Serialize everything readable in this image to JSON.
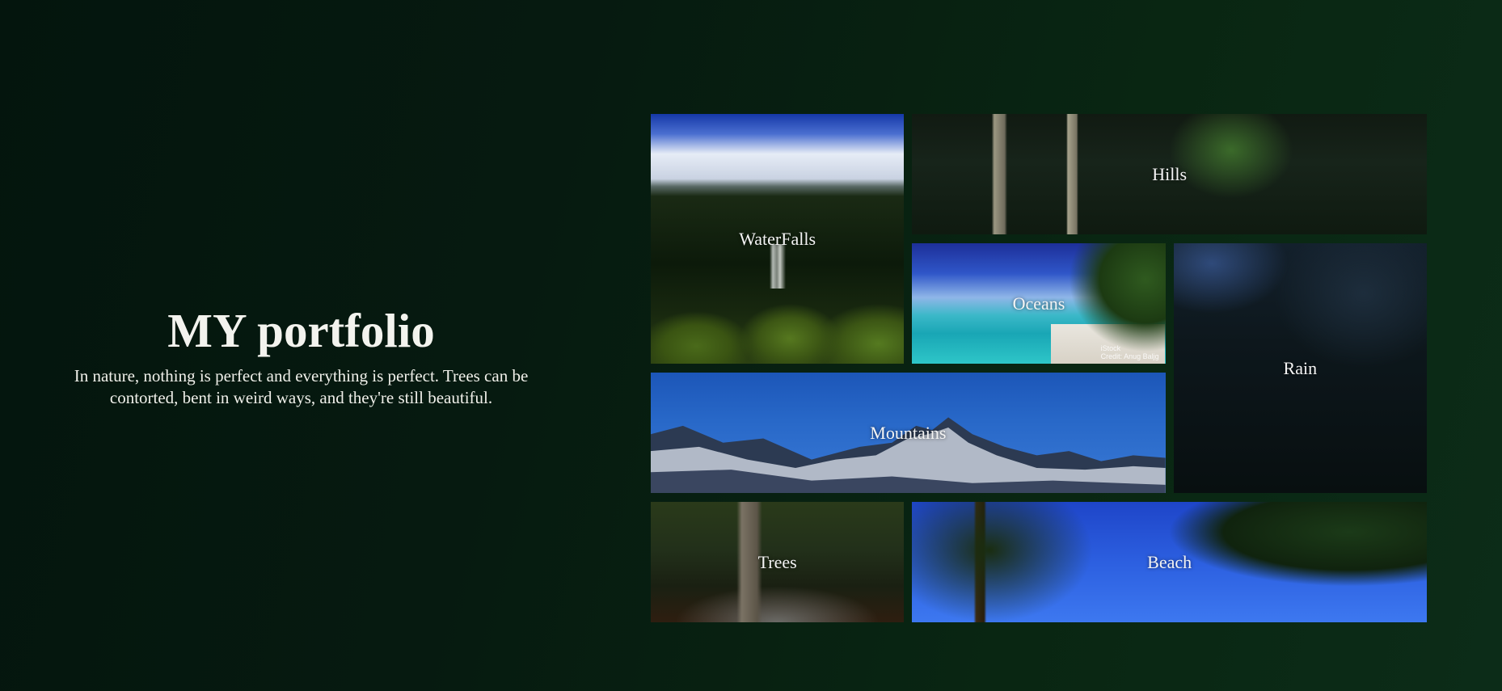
{
  "intro": {
    "title": "MY portfolio",
    "description": "In nature, nothing is perfect and everything is perfect. Trees can be contorted, bent in weird ways, and they're still beautiful."
  },
  "gallery": {
    "tiles": [
      {
        "label": "WaterFalls"
      },
      {
        "label": "Hills"
      },
      {
        "label": "Oceans"
      },
      {
        "label": "Rain"
      },
      {
        "label": "Mountains"
      },
      {
        "label": "Trees"
      },
      {
        "label": "Beach"
      }
    ]
  }
}
